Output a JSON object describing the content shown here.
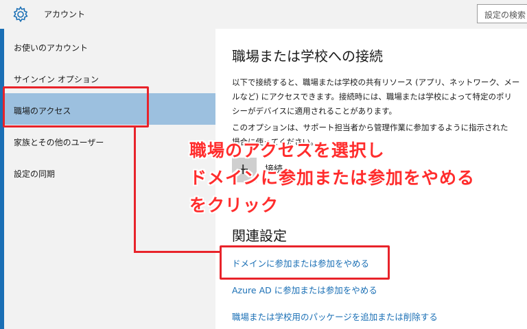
{
  "window": {
    "title": "アカウント",
    "search_placeholder": "設定の検索",
    "icon": "gear-icon"
  },
  "sidebar": {
    "items": [
      {
        "label": "お使いのアカウント",
        "selected": false
      },
      {
        "label": "サインイン オプション",
        "selected": false
      },
      {
        "label": "職場のアクセス",
        "selected": true
      },
      {
        "label": "家族とその他のユーザー",
        "selected": false
      },
      {
        "label": "設定の同期",
        "selected": false
      }
    ]
  },
  "main": {
    "title": "職場または学校への接続",
    "description_lines": [
      "以下で接続すると、職場または学校の共有リソース (アプリ、ネットワーク、メー",
      "ルなど) にアクセスできます。接続時には、職場または学校によって特定のポリ",
      "シーがデバイスに適用されることがあります。"
    ],
    "option_lines": [
      "このオプションは、サポート担当者から管理作業に参加するように指示された",
      "場合に使ってください。"
    ],
    "connect_label": "接続",
    "related_title": "関連設定",
    "links": [
      "ドメインに参加または参加をやめる",
      "Azure AD に参加または参加をやめる",
      "職場または学校用のパッケージを追加または削除する"
    ]
  },
  "annotation": {
    "lines": [
      "職場のアクセスを選択し",
      "ドメインに参加または参加をやめる",
      "をクリック"
    ],
    "color": "#e8232a"
  },
  "colors": {
    "accent": "#1a6fb5",
    "selected_bg": "#9cc0df",
    "sidebar_bg": "#f2f2f2",
    "link": "#1a6fb5"
  }
}
